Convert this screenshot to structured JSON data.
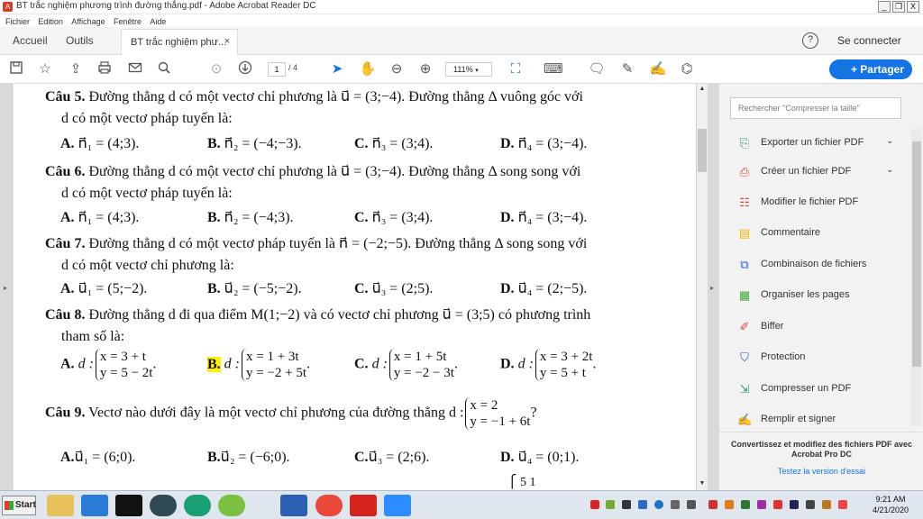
{
  "window": {
    "title": "BT trắc nghiệm phương trình đường thẳng.pdf - Adobe Acrobat Reader DC",
    "app_icon_letter": "A",
    "min": "_",
    "max": "❐",
    "close": "X"
  },
  "menu": [
    "Fichier",
    "Edition",
    "Affichage",
    "Fenêtre",
    "Aide"
  ],
  "tabs": {
    "home": "Accueil",
    "tools": "Outils",
    "doc": "BT trắc nghiệm phư...",
    "doc_close": "×",
    "help": "?",
    "signin": "Se connecter"
  },
  "toolbar": {
    "page_current": "1",
    "page_total": "/ 4",
    "zoom": "111%",
    "share": "Partager"
  },
  "doc": {
    "q5": {
      "head": "Câu 5.",
      "line1": "Đường thẳng d có một vectơ chỉ phương là u⃗ = (3;−4). Đường thẳng Δ vuông góc với",
      "line2": "d có một vectơ pháp tuyến là:",
      "a": "A.",
      "a_val": "n⃗₁ = (4;3).",
      "b": "B.",
      "b_val": "n⃗₂ = (−4;−3).",
      "c": "C.",
      "c_val": "n⃗₃ = (3;4).",
      "d": "D.",
      "d_val": "n⃗₄ = (3;−4)."
    },
    "q6": {
      "head": "Câu 6.",
      "line1": "Đường thẳng d có một vectơ chỉ phương là u⃗ = (3;−4). Đường thẳng Δ song song với",
      "line2": "d có một vectơ pháp tuyến là:",
      "a": "A.",
      "a_val": "n⃗₁ = (4;3).",
      "b": "B.",
      "b_val": "n⃗₂ = (−4;3).",
      "c": "C.",
      "c_val": "n⃗₃ = (3;4).",
      "d": "D.",
      "d_val": "n⃗₄ = (3;−4)."
    },
    "q7": {
      "head": "Câu 7.",
      "line1": "Đường thẳng d có một vectơ pháp tuyến là n⃗ = (−2;−5). Đường thẳng Δ song song với",
      "line2": "d có một vectơ chỉ phương là:",
      "a": "A.",
      "a_val": "u⃗₁ = (5;−2).",
      "b": "B.",
      "b_val": "u⃗₂ = (−5;−2).",
      "c": "C.",
      "c_val": "u⃗₃ = (2;5).",
      "d": "D.",
      "d_val": "u⃗₄ = (2;−5)."
    },
    "q8": {
      "head": "Câu 8.",
      "line1": "Đường thẳng d đi qua điểm M(1;−2) và có vectơ chỉ phương u⃗ = (3;5) có phương trình",
      "line2": "tham số là:",
      "a": "A.",
      "a_pre": "d :",
      "a_r1": "x = 3 + t",
      "a_r2": "y = 5 − 2t",
      "b": "B.",
      "b_pre": "d :",
      "b_r1": "x = 1 + 3t",
      "b_r2": "y = −2 + 5t",
      "c": "C.",
      "c_pre": "d :",
      "c_r1": "x = 1 + 5t",
      "c_r2": "y = −2 − 3t",
      "d": "D.",
      "d_pre": "d :",
      "d_r1": "x = 3 + 2t",
      "d_r2": "y = 5 + t",
      "dot": "."
    },
    "q9": {
      "head": "Câu 9.",
      "line1": "Vectơ nào dưới đây là một vectơ chỉ phương của đường thẳng d :",
      "sys_r1": "x = 2",
      "sys_r2": "y = −1 + 6t",
      "qm": "?",
      "a": "A.",
      "a_val": "u⃗₁ = (6;0).",
      "b": "B.",
      "b_val": "u⃗₂ = (−6;0).",
      "c": "C.",
      "c_val": "u⃗₃ = (2;6).",
      "d": "D.",
      "d_val": "u⃗₄ = (0;1)."
    },
    "cut_fragment": "⎧  5  1"
  },
  "rpanel": {
    "search_placeholder": "Rechercher \"Compresser la taille\"",
    "tools": [
      {
        "label": "Exporter un fichier PDF",
        "color": "#2d9b87"
      },
      {
        "label": "Créer un fichier PDF",
        "color": "#e0443e"
      },
      {
        "label": "Modifier le fichier PDF",
        "color": "#e0443e"
      },
      {
        "label": "Commentaire",
        "color": "#f2b705"
      },
      {
        "label": "Combinaison de fichiers",
        "color": "#2b62d9"
      },
      {
        "label": "Organiser les pages",
        "color": "#3aaa35"
      },
      {
        "label": "Biffer",
        "color": "#e0443e"
      },
      {
        "label": "Protection",
        "color": "#2b62d9"
      },
      {
        "label": "Compresser un PDF",
        "color": "#2d9b87"
      },
      {
        "label": "Remplir et signer",
        "color": "#7a4ec9"
      }
    ],
    "chevron": "⌄",
    "promo_title": "Convertissez et modifiez des fichiers PDF avec Acrobat Pro DC",
    "promo_link": "Testez la version d'essai"
  },
  "taskbar": {
    "start": "Start",
    "time": "9:21 AM",
    "date": "4/21/2020"
  }
}
